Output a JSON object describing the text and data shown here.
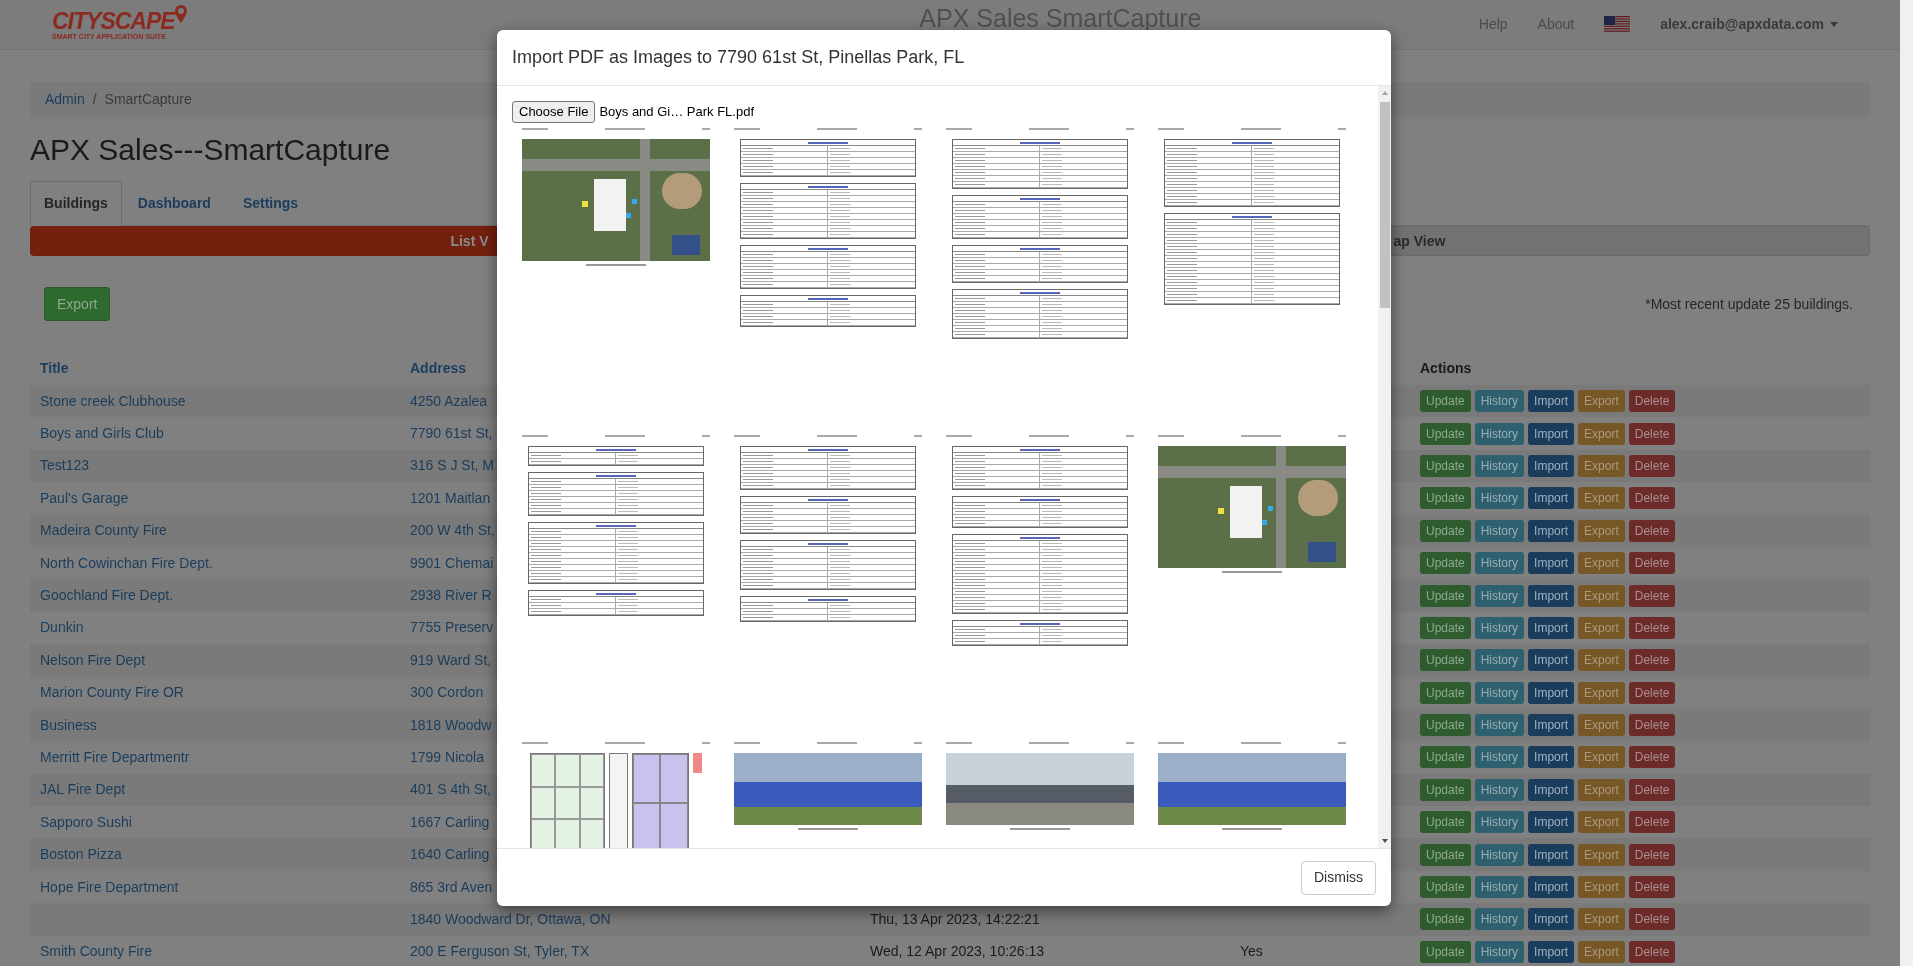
{
  "navbar": {
    "logo_text": "CITYSCAPE",
    "logo_tagline": "SMART CITY APPLICATION SUITE",
    "title": "APX Sales SmartCapture",
    "links": [
      "Help",
      "About"
    ],
    "user": "alex.craib@apxdata.com"
  },
  "breadcrumb": {
    "items": [
      "Admin",
      "SmartCapture"
    ],
    "separator": "/"
  },
  "heading": "APX Sales---SmartCapture",
  "tabs": [
    {
      "label": "Buildings",
      "selected": true
    },
    {
      "label": "Dashboard",
      "selected": false
    },
    {
      "label": "Settings",
      "selected": false
    }
  ],
  "view_toggle": [
    {
      "label": "List V",
      "selected": true
    },
    {
      "label": "ap View",
      "selected": false
    }
  ],
  "export_button": "Export",
  "update_note": "*Most recent update 25 buildings.",
  "table": {
    "columns": [
      "Title",
      "Address",
      "Actions"
    ],
    "rows": [
      {
        "title": "Stone creek Clubhouse",
        "address": "4250 Azalea",
        "actions": [
          "Update",
          "History",
          "Import",
          "Export",
          "Delete"
        ]
      },
      {
        "title": "Boys and Girls Club",
        "address": "7790 61st St,",
        "actions": [
          "Update",
          "History",
          "Import",
          "Export",
          "Delete"
        ]
      },
      {
        "title": "Test123",
        "address": "316 S J St, M",
        "actions": [
          "Update",
          "History",
          "Import",
          "Export",
          "Delete"
        ]
      },
      {
        "title": "Paul's Garage",
        "address": "1201 Maitlan",
        "actions": [
          "Update",
          "History",
          "Import",
          "Export",
          "Delete"
        ]
      },
      {
        "title": "Madeira County Fire",
        "address": "200 W 4th St,",
        "actions": [
          "Update",
          "History",
          "Import",
          "Export",
          "Delete"
        ]
      },
      {
        "title": "North Cowinchan Fire Dept.",
        "address": "9901 Chemai",
        "actions": [
          "Update",
          "History",
          "Import",
          "Export",
          "Delete"
        ]
      },
      {
        "title": "Goochland Fire Dept.",
        "address": "2938 River R",
        "actions": [
          "Update",
          "History",
          "Import",
          "Export",
          "Delete"
        ]
      },
      {
        "title": "Dunkin",
        "address": "7755 Preserv",
        "actions": [
          "Update",
          "History",
          "Import",
          "Export",
          "Delete"
        ]
      },
      {
        "title": "Nelson Fire Dept",
        "address": "919 Ward St,",
        "actions": [
          "Update",
          "History",
          "Import",
          "Export",
          "Delete"
        ]
      },
      {
        "title": "Marion County Fire OR",
        "address": "300 Cordon",
        "actions": [
          "Update",
          "History",
          "Import",
          "Export",
          "Delete"
        ]
      },
      {
        "title": "Business",
        "address": "1818 Woodw",
        "actions": [
          "Update",
          "History",
          "Import",
          "Export",
          "Delete"
        ]
      },
      {
        "title": "Merritt Fire Departmentr",
        "address": "1799 Nicola",
        "actions": [
          "Update",
          "History",
          "Import",
          "Export",
          "Delete"
        ]
      },
      {
        "title": "JAL Fire Dept",
        "address": "401 S 4th St,",
        "actions": [
          "Update",
          "History",
          "Import",
          "Export",
          "Delete"
        ]
      },
      {
        "title": "Sapporo Sushi",
        "address": "1667 Carling",
        "actions": [
          "Update",
          "History",
          "Import",
          "Export",
          "Delete"
        ]
      },
      {
        "title": "Boston Pizza",
        "address": "1640 Carling",
        "actions": [
          "Update",
          "History",
          "Import",
          "Export",
          "Delete"
        ]
      },
      {
        "title": "Hope Fire Department",
        "address": "865 3rd Aven",
        "actions": [
          "Update",
          "History",
          "Import",
          "Export",
          "Delete"
        ]
      },
      {
        "address": "1840 Woodward Dr, Ottawa, ON",
        "column_3": "Thu, 13 Apr 2023, 14:22:21",
        "actions": [
          "Update",
          "History",
          "Import",
          "Export",
          "Delete"
        ]
      },
      {
        "title": "Smith County Fire",
        "address": "200 E Ferguson St, Tyler, TX",
        "column_3": "Wed, 12 Apr 2023, 10:26:13",
        "column_4": "Yes",
        "actions": [
          "Update",
          "History",
          "Import",
          "Export",
          "Delete"
        ]
      }
    ]
  },
  "modal": {
    "title": "Import PDF as Images to 7790 61st St, Pinellas Park, FL",
    "file_button": "Choose File",
    "file_name": "Boys and Gi… Park FL.pdf",
    "pages": [
      {
        "kind": "aerial"
      },
      {
        "kind": "form"
      },
      {
        "kind": "form"
      },
      {
        "kind": "form"
      },
      {
        "kind": "form"
      },
      {
        "kind": "form"
      },
      {
        "kind": "form"
      },
      {
        "kind": "aerial"
      },
      {
        "kind": "floor_plan"
      },
      {
        "kind": "photo"
      },
      {
        "kind": "photo"
      },
      {
        "kind": "photo"
      }
    ],
    "dismiss": "Dismiss"
  }
}
